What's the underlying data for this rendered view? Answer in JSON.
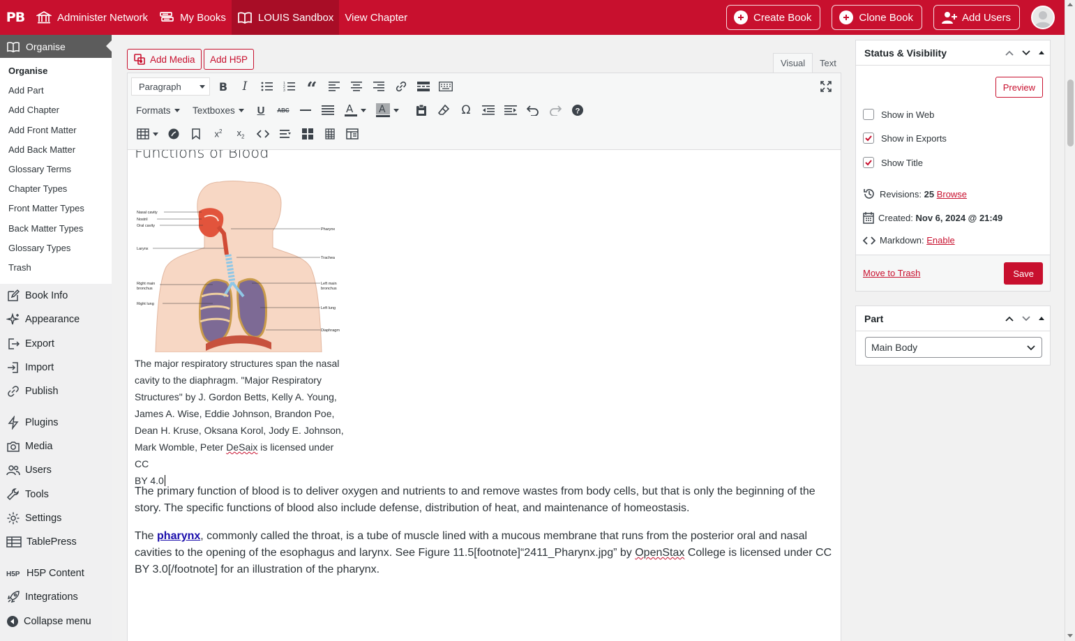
{
  "topbar": {
    "logo": "PB",
    "items": [
      {
        "label": "Administer Network",
        "icon": "bank-icon"
      },
      {
        "label": "My Books",
        "icon": "books-icon"
      },
      {
        "label": "LOUIS Sandbox",
        "icon": "book-open-icon"
      },
      {
        "label": "View Chapter"
      }
    ],
    "buttons": [
      {
        "label": "Create Book",
        "icon": "plus-circle-icon"
      },
      {
        "label": "Clone Book",
        "icon": "clone-icon"
      },
      {
        "label": "Add Users",
        "icon": "user-plus-icon"
      }
    ],
    "accent_color": "#c8102e"
  },
  "sidebar": {
    "current": "Organise",
    "submenu": [
      "Organise",
      "Add Part",
      "Add Chapter",
      "Add Front Matter",
      "Add Back Matter",
      "Glossary Terms",
      "Chapter Types",
      "Front Matter Types",
      "Back Matter Types",
      "Glossary Types",
      "Trash"
    ],
    "menu": [
      {
        "label": "Book Info",
        "icon": "edit-icon"
      },
      {
        "label": "Appearance",
        "icon": "sparkle-icon"
      },
      {
        "label": "Export",
        "icon": "export-icon"
      },
      {
        "label": "Import",
        "icon": "import-icon"
      },
      {
        "label": "Publish",
        "icon": "link-icon"
      },
      {
        "label": "Plugins",
        "icon": "bolt-icon"
      },
      {
        "label": "Media",
        "icon": "camera-icon"
      },
      {
        "label": "Users",
        "icon": "users-icon"
      },
      {
        "label": "Tools",
        "icon": "wrench-icon"
      },
      {
        "label": "Settings",
        "icon": "gear-icon"
      },
      {
        "label": "TablePress",
        "icon": "table-icon"
      },
      {
        "label": "H5P Content",
        "icon": "h5p-icon"
      },
      {
        "label": "Integrations",
        "icon": "rocket-icon"
      },
      {
        "label": "Collapse menu",
        "icon": "collapse-icon"
      }
    ]
  },
  "editor": {
    "add_media": "Add Media",
    "add_h5p": "Add H5P",
    "tab_visual": "Visual",
    "tab_text": "Text",
    "format_select": "Paragraph",
    "formats_label": "Formats",
    "textboxes_label": "Textboxes",
    "heading": "Functions of Blood",
    "figure_labels": {
      "nasal_cavity": "Nasal cavity",
      "nostril": "Nostril",
      "oral_cavity": "Oral cavity",
      "larynx": "Larynx",
      "right_main": "Right main",
      "bronchus": "bronchus",
      "right_lung": "Right lung",
      "pharynx": "Pharynx",
      "trachea": "Trachea",
      "left_main": "Left main",
      "left_lung": "Left lung",
      "diaphragm": "Diaphragm"
    },
    "caption_lines": [
      "The major respiratory structures span the nasal",
      "cavity to the diaphragm. \"Major Respiratory",
      "Structures\" by J. Gordon Betts, Kelly A. Young,",
      "James A. Wise, Eddie Johnson, Brandon Poe,",
      "Dean H. Kruse, Oksana Korol, Jody E. Johnson,"
    ],
    "caption_line6_pre": "Mark Womble, Peter ",
    "caption_line6_name": "DeSaix",
    "caption_line6_post": " is licensed under CC",
    "caption_line7": "BY 4.0",
    "para1": "The primary function of blood is to deliver oxygen and nutrients to and remove wastes from body cells, but that is only the beginning of the story. The specific functions of blood also include defense, distribution of heat, and maintenance of homeostasis.",
    "para2_pre": "The ",
    "para2_link": "pharynx",
    "para2_mid": ", commonly called the throat, is a tube of muscle lined with a mucous membrane that runs from the posterior oral and nasal cavi­ties to the opening of the esophagus and larynx. See Figure 11.5[footnote]“2411_Pharynx.jpg” by ",
    "para2_name": "OpenStax",
    "para2_post": " College is licensed under CC BY 3.0[/footnote] for an illustration of the pharynx."
  },
  "status_box": {
    "title": "Status & Visibility",
    "preview": "Preview",
    "checks": [
      {
        "label": "Show in Web",
        "checked": false
      },
      {
        "label": "Show in Exports",
        "checked": true
      },
      {
        "label": "Show Title",
        "checked": true
      }
    ],
    "revisions_label": "Revisions:",
    "revisions_count": "25",
    "browse": "Browse",
    "created_label": "Created:",
    "created_value": "Nov 6, 2024 @ 21:49",
    "markdown_label": "Markdown:",
    "markdown_link": "Enable",
    "move_to_trash": "Move to Trash",
    "save": "Save"
  },
  "part_box": {
    "title": "Part",
    "selected": "Main Body"
  }
}
